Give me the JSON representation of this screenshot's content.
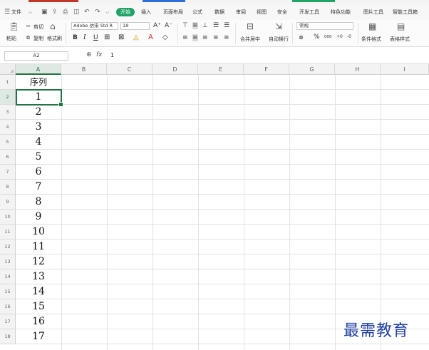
{
  "menu": {
    "file": "文件",
    "start": "开始",
    "tabs": [
      "插入",
      "页面布局",
      "公式",
      "数据",
      "审阅",
      "视图",
      "安全",
      "开发工具",
      "特色功能",
      "图片工具",
      "智能工具箱"
    ]
  },
  "toolbar": {
    "paste": "粘贴",
    "cut": "剪切",
    "copy": "复制",
    "format_painter": "格式刷",
    "font_name": "Adobe 仿宋 Std R",
    "font_size": "18",
    "bold": "B",
    "italic": "I",
    "underline": "U",
    "grow_font": "A⁺",
    "shrink_font": "A⁻",
    "merge_center": "合并居中",
    "wrap_text": "自动换行",
    "number_format": "常规",
    "percent": "%",
    "thousands": "000",
    "conditional_format": "条件格式",
    "table_style": "表格样式"
  },
  "formula_bar": {
    "name_box": "A2",
    "fx": "fx",
    "value": "1"
  },
  "sheet": {
    "columns": [
      "A",
      "B",
      "C",
      "D",
      "E",
      "F",
      "G",
      "H",
      "I"
    ],
    "rows": [
      "1",
      "2",
      "3",
      "4",
      "5",
      "6",
      "7",
      "8",
      "9",
      "10",
      "11",
      "12",
      "13",
      "14",
      "15",
      "16",
      "17",
      "18"
    ],
    "column_a": [
      "序列",
      "1",
      "2",
      "3",
      "4",
      "5",
      "6",
      "7",
      "8",
      "9",
      "10",
      "11",
      "12",
      "13",
      "14",
      "15",
      "16",
      "17"
    ],
    "selected_cell": "A2"
  },
  "watermark": "最需教育",
  "colors": {
    "accent": "#217346",
    "start_tab": "#21a366",
    "watermark": "#1f3fa0"
  }
}
